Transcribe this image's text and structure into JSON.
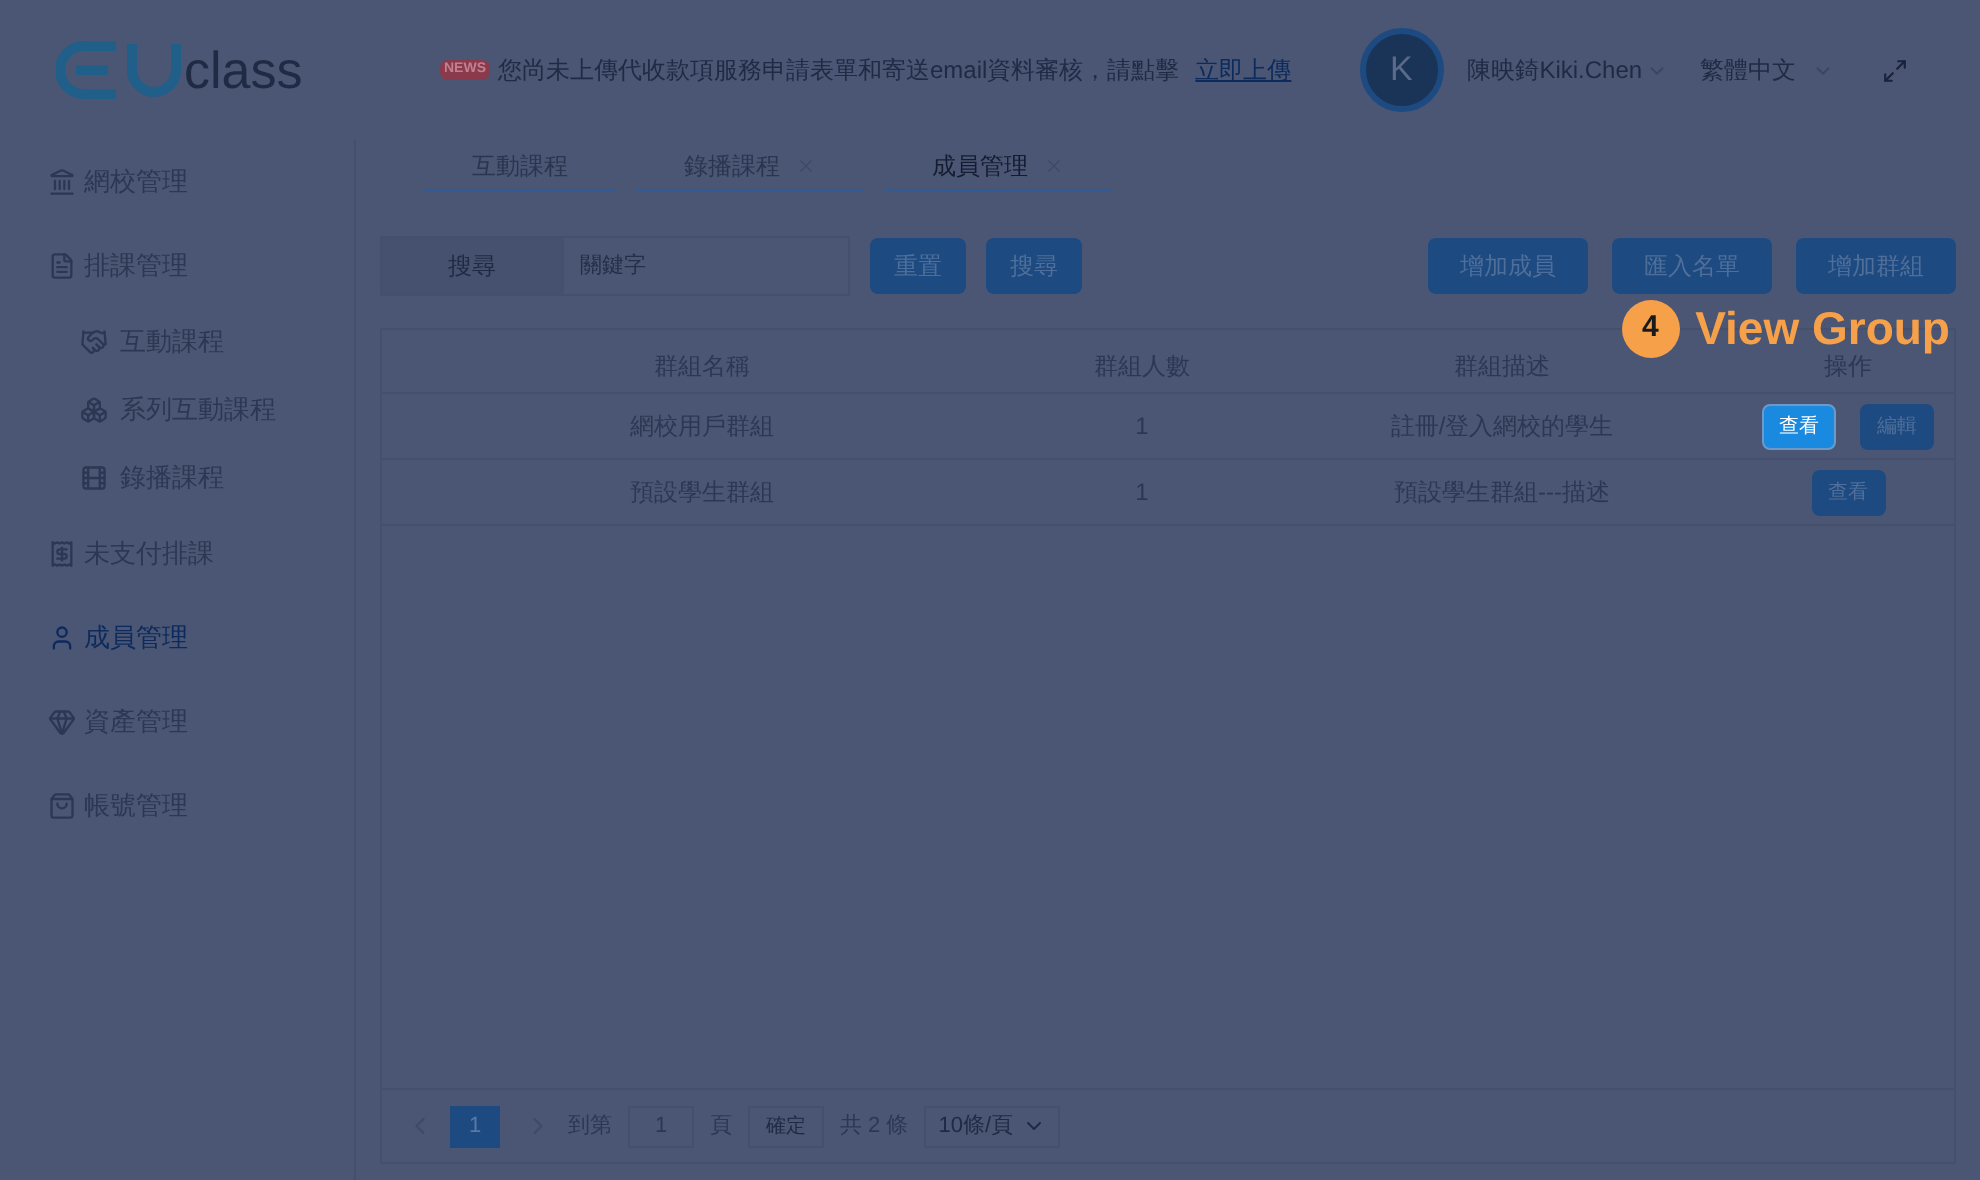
{
  "logo": {
    "text": "class"
  },
  "notice": {
    "badge": "NEWS",
    "text": "您尚未上傳代收款項服務申請表單和寄送email資料審核，請點擊",
    "link": "立即上傳"
  },
  "user": {
    "avatar": "K",
    "name": "陳映錡Kiki.Chen"
  },
  "language": "繁體中文",
  "sidebar": {
    "items": [
      {
        "label": "網校管理",
        "selected": false
      },
      {
        "label": "排課管理",
        "selected": false,
        "children": [
          {
            "label": "互動課程",
            "selected": false
          },
          {
            "label": "系列互動課程",
            "selected": false
          },
          {
            "label": "錄播課程",
            "selected": false
          }
        ]
      },
      {
        "label": "未支付排課",
        "selected": false
      },
      {
        "label": "成員管理",
        "selected": true
      },
      {
        "label": "資產管理",
        "selected": false
      },
      {
        "label": "帳號管理",
        "selected": false
      }
    ]
  },
  "tabs": [
    {
      "label": "互動課程",
      "closable": false,
      "selected": false
    },
    {
      "label": "錄播課程",
      "closable": true,
      "selected": false
    },
    {
      "label": "成員管理",
      "closable": true,
      "selected": true
    }
  ],
  "search": {
    "label": "搜尋",
    "placeholder": "關鍵字"
  },
  "search_buttons": [
    "重置",
    "搜尋"
  ],
  "actions": [
    "增加成員",
    "匯入名單",
    "增加群組"
  ],
  "annotation": {
    "number": "4",
    "text": "View Group"
  },
  "table": {
    "columns": [
      "群組名稱",
      "群組人數",
      "群組描述",
      "操作"
    ],
    "rows": [
      {
        "cells": [
          "網校用戶群組",
          "1",
          "註冊/登入網校的學生"
        ],
        "actions": [
          {
            "label": "查看",
            "highlighted": true
          },
          {
            "label": "編輯",
            "highlighted": false
          }
        ]
      },
      {
        "cells": [
          "預設學生群組",
          "1",
          "預設學生群組---描述"
        ],
        "actions": [
          {
            "label": "查看",
            "highlighted": false
          }
        ]
      }
    ]
  },
  "pagination": {
    "pages": [
      {
        "label": "1",
        "selected": true
      }
    ],
    "goto_label": "到第",
    "page_value": "1",
    "page_suffix": "頁",
    "confirm": "確定",
    "total": "共 2 條",
    "page_size": "10條/頁"
  }
}
